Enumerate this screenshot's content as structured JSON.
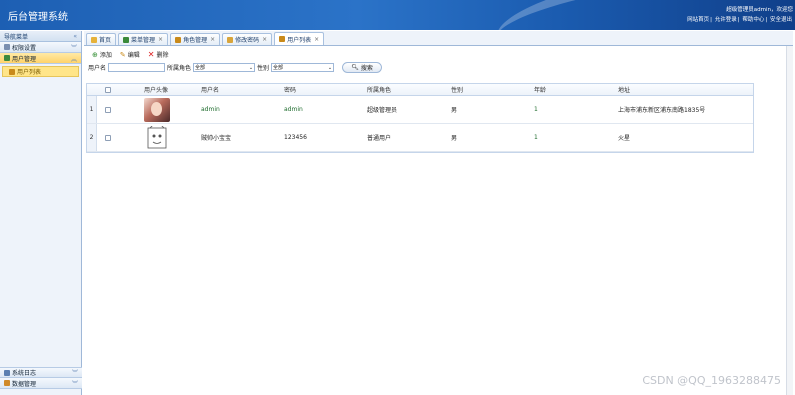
{
  "header": {
    "title": "后台管理系统",
    "welcome": "超级管理员admin，欢迎您",
    "links": [
      "网站首页",
      "允许登录",
      "帮助中心",
      "安全退出"
    ]
  },
  "sidebar": {
    "heading": "导航菜单",
    "groups": [
      {
        "label": "权限设置",
        "icon": "tools-icon"
      },
      {
        "label": "用户管理",
        "icon": "users-icon"
      }
    ],
    "active_item": "用户列表",
    "bottom_groups": [
      {
        "label": "系统日志",
        "icon": "log-icon"
      },
      {
        "label": "数据管理",
        "icon": "data-icon"
      }
    ]
  },
  "tabs": [
    {
      "label": "首页",
      "closable": false
    },
    {
      "label": "菜单管理",
      "closable": true
    },
    {
      "label": "角色管理",
      "closable": true
    },
    {
      "label": "修改密码",
      "closable": true
    },
    {
      "label": "用户列表",
      "closable": true
    }
  ],
  "toolbar": {
    "add": "添加",
    "edit": "编辑",
    "delete": "删除"
  },
  "filter": {
    "username_label": "用户名",
    "role_label": "所属角色",
    "role_value": "全部",
    "gender_label": "性别",
    "gender_value": "全部",
    "search": "搜索"
  },
  "table": {
    "columns": [
      "用户头像",
      "用户名",
      "密码",
      "所属角色",
      "性别",
      "年龄",
      "地址"
    ],
    "rows": [
      {
        "num": "1",
        "username": "admin",
        "password": "admin",
        "role": "超级管理员",
        "gender": "男",
        "age": "1",
        "address": "上海市浦东新区浦东南路1835号"
      },
      {
        "num": "2",
        "username": "贼帅小宝宝",
        "password": "123456",
        "role": "普通用户",
        "gender": "男",
        "age": "1",
        "address": "火星"
      }
    ]
  },
  "watermark": "CSDN @QQ_1963288475",
  "colors": {
    "header": "#1d5fb3",
    "active": "#ffd36a"
  }
}
